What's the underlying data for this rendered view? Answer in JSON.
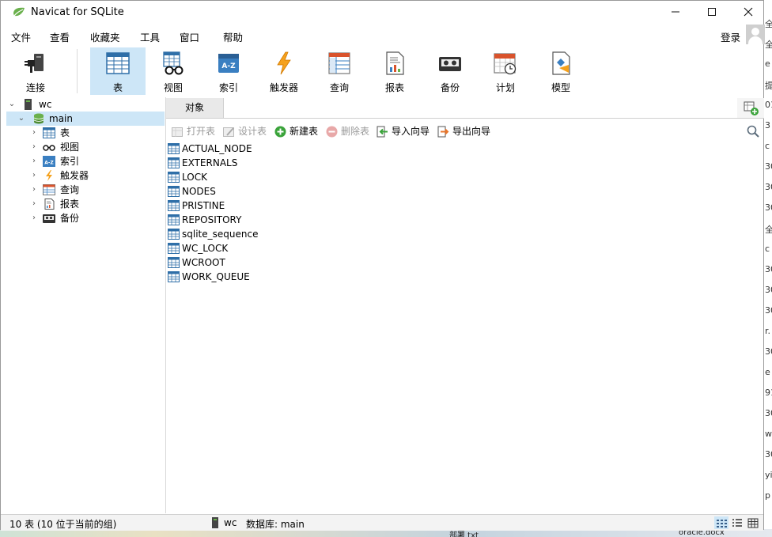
{
  "window": {
    "title": "Navicat for SQLite"
  },
  "menu": [
    "文件",
    "查看",
    "收藏夹",
    "工具",
    "窗口",
    "帮助"
  ],
  "login_label": "登录",
  "toolbar": {
    "connect": "连接",
    "items": [
      "表",
      "视图",
      "索引",
      "触发器",
      "查询",
      "报表",
      "备份",
      "计划",
      "模型"
    ],
    "active": "表"
  },
  "tree": {
    "connection": "wc",
    "database": "main",
    "nodes": [
      "表",
      "视图",
      "索引",
      "触发器",
      "查询",
      "报表",
      "备份"
    ]
  },
  "tabs": {
    "objects": "对象"
  },
  "object_toolbar": {
    "open": "打开表",
    "design": "设计表",
    "new": "新建表",
    "delete": "删除表",
    "import": "导入向导",
    "export": "导出向导"
  },
  "tables": [
    "ACTUAL_NODE",
    "EXTERNALS",
    "LOCK",
    "NODES",
    "PRISTINE",
    "REPOSITORY",
    "sqlite_sequence",
    "WC_LOCK",
    "WCROOT",
    "WORK_QUEUE"
  ],
  "status": {
    "summary": "10 表 (10 位于当前的组)",
    "connection": "wc",
    "database": "数据库: main"
  },
  "desktop": {
    "right_fragments": [
      "全",
      "全",
      "e",
      "提",
      "01",
      "3",
      "c",
      "30",
      "30",
      "30",
      "全",
      "c",
      "30",
      "30",
      "30",
      "r.",
      "30",
      "e",
      "91",
      "30",
      "wi",
      "30",
      "yi",
      "p"
    ],
    "bottom_fragments": [
      "部署 txt",
      "oracle.docx"
    ]
  },
  "colors": {
    "selection": "#cde6f7",
    "accent": "#2c7fbf"
  }
}
